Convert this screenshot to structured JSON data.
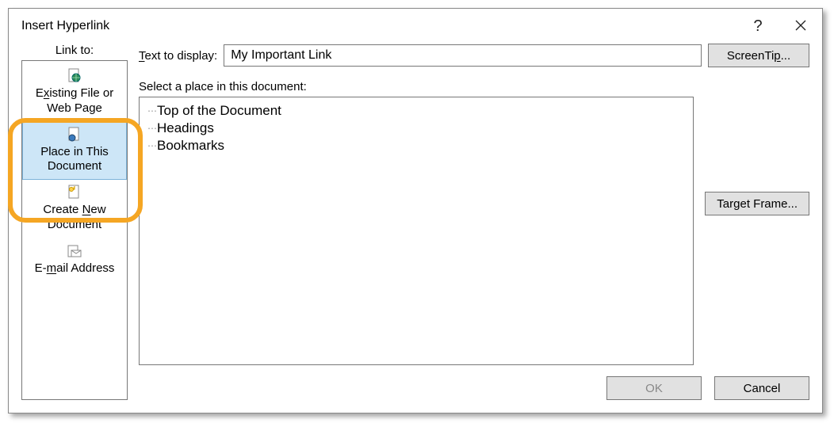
{
  "dialog": {
    "title": "Insert Hyperlink",
    "help_tooltip": "?",
    "close_tooltip": "Close"
  },
  "linkto": {
    "label": "Link to:",
    "items": [
      {
        "id": "existing",
        "label_pre": "E",
        "accel": "x",
        "label_post": "isting File or Web Page",
        "l1": "Existing File or",
        "l2": "Web Page"
      },
      {
        "id": "place",
        "label": "Place in This Document",
        "l1": "Place in This",
        "l2": "Document"
      },
      {
        "id": "create",
        "label_pre": "Create ",
        "accel": "N",
        "label_post": "ew Document",
        "l1": "Create New",
        "l2": "Document"
      },
      {
        "id": "email",
        "label_pre": "E-",
        "accel": "m",
        "label_post": "ail Address",
        "l1": "E-mail Address",
        "l2": ""
      }
    ],
    "selected": "place"
  },
  "text_to_display": {
    "label_pre": "",
    "accel": "T",
    "label_post": "ext to display:",
    "value": "My Important Link"
  },
  "screentip": {
    "label": "ScreenTip..."
  },
  "select_place": {
    "label": "Select a place in this document:",
    "items": [
      "Top of the Document",
      "Headings",
      "Bookmarks"
    ]
  },
  "target_frame": {
    "label": "Target Frame..."
  },
  "ok": {
    "label": "OK"
  },
  "cancel": {
    "label": "Cancel"
  }
}
